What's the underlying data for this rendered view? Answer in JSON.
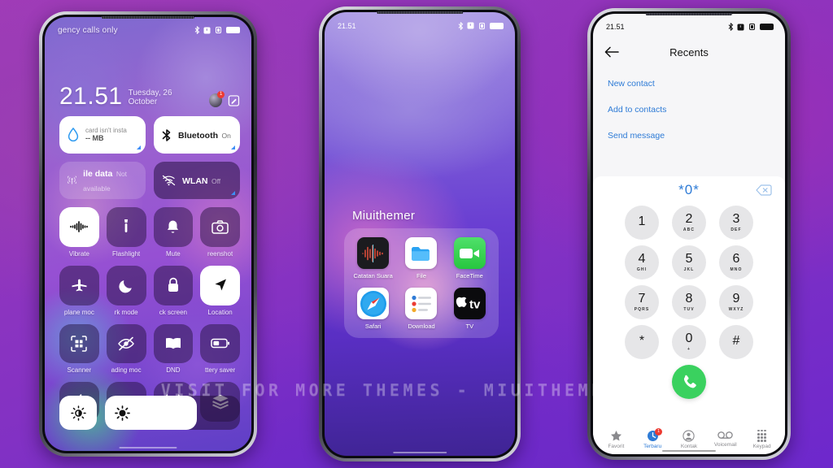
{
  "watermark": "VISIT FOR MORE THEMES - MIUITHEMER.COM",
  "phone_left": {
    "status": {
      "carrier": "gency calls only",
      "icons": [
        "bluetooth-icon",
        "alarm-icon",
        "vibrate-icon",
        "battery-icon"
      ]
    },
    "clock": {
      "time": "21.51",
      "date": "Tuesday, 26 October",
      "notification_count": "1"
    },
    "big_tiles": [
      {
        "name": "sim",
        "title": "card isn't insta",
        "subtitle": "-- MB",
        "state": "on",
        "icon": "water-drop-icon"
      },
      {
        "name": "bluetooth",
        "title": "Bluetooth",
        "subtitle": "On",
        "state": "on",
        "icon": "bluetooth-icon"
      },
      {
        "name": "mobile-data",
        "title": "ile data",
        "subtitle": "Not available",
        "state": "off",
        "icon": "signal-icon"
      },
      {
        "name": "wlan",
        "title": "WLAN",
        "subtitle": "Off",
        "state": "dim",
        "icon": "wifi-off-icon"
      }
    ],
    "tiles": [
      {
        "label": "Vibrate",
        "icon": "vibrate-icon",
        "active": true
      },
      {
        "label": "Flashlight",
        "icon": "flashlight-icon",
        "active": false
      },
      {
        "label": "Mute",
        "icon": "bell-icon",
        "active": false
      },
      {
        "label": "reenshot",
        "icon": "camera-icon",
        "active": false
      },
      {
        "label": "plane moc",
        "icon": "airplane-icon",
        "active": false
      },
      {
        "label": "rk mode",
        "icon": "moon-icon",
        "active": false
      },
      {
        "label": "ck screen",
        "icon": "lock-icon",
        "active": false
      },
      {
        "label": "Location",
        "icon": "location-icon",
        "active": true
      },
      {
        "label": "Scanner",
        "icon": "scanner-icon",
        "active": false
      },
      {
        "label": "ading moc",
        "icon": "eye-off-icon",
        "active": false
      },
      {
        "label": "DND",
        "icon": "book-icon",
        "active": false
      },
      {
        "label": "ttery saver",
        "icon": "battery-saver-icon",
        "active": false
      },
      {
        "label": "",
        "icon": "bolt-icon",
        "active": false
      },
      {
        "label": "",
        "icon": "cast-icon",
        "active": false
      },
      {
        "label": "",
        "icon": "hotspot-icon",
        "active": false
      },
      {
        "label": "",
        "icon": "layers-icon",
        "active": false
      }
    ],
    "brightness": {
      "auto_icon": "auto-brightness-icon",
      "slider_icon": "brightness-icon",
      "value": 68
    }
  },
  "phone_center": {
    "status": {
      "time": "21.51",
      "icons": [
        "bluetooth-icon",
        "alarm-icon",
        "vibrate-icon",
        "battery-icon"
      ]
    },
    "folder_title": "Miuithemer",
    "apps": [
      {
        "label": "Catatan Suara",
        "icon": "voice-memos-icon"
      },
      {
        "label": "File",
        "icon": "files-icon"
      },
      {
        "label": "FaceTime",
        "icon": "facetime-icon"
      },
      {
        "label": "Safari",
        "icon": "safari-icon"
      },
      {
        "label": "Download",
        "icon": "reminders-icon"
      },
      {
        "label": "TV",
        "icon": "apple-tv-icon"
      }
    ]
  },
  "phone_right": {
    "status": {
      "time": "21.51",
      "icons": [
        "bluetooth-icon",
        "alarm-icon",
        "vibrate-icon",
        "battery-icon"
      ]
    },
    "header": {
      "back_icon": "back-arrow-icon",
      "title": "Recents"
    },
    "actions": [
      "New contact",
      "Add to contacts",
      "Send message"
    ],
    "dial": {
      "number": "*0*",
      "delete_icon": "backspace-icon",
      "keys": [
        {
          "num": "1",
          "letters": ""
        },
        {
          "num": "2",
          "letters": "ABC"
        },
        {
          "num": "3",
          "letters": "DEF"
        },
        {
          "num": "4",
          "letters": "GHI"
        },
        {
          "num": "5",
          "letters": "JKL"
        },
        {
          "num": "6",
          "letters": "MNO"
        },
        {
          "num": "7",
          "letters": "PQRS"
        },
        {
          "num": "8",
          "letters": "TUV"
        },
        {
          "num": "9",
          "letters": "WXYZ"
        },
        {
          "num": "*",
          "letters": ""
        },
        {
          "num": "0",
          "letters": "+"
        },
        {
          "num": "#",
          "letters": ""
        }
      ],
      "call_icon": "phone-call-icon"
    },
    "tabs": [
      {
        "label": "Favorit",
        "icon": "star-icon",
        "active": false,
        "badge": ""
      },
      {
        "label": "Terbaru",
        "icon": "recents-icon",
        "active": true,
        "badge": "1"
      },
      {
        "label": "Kontak",
        "icon": "contacts-icon",
        "active": false,
        "badge": ""
      },
      {
        "label": "Voicemail",
        "icon": "voicemail-icon",
        "active": false,
        "badge": ""
      },
      {
        "label": "Keypad",
        "icon": "keypad-icon",
        "active": false,
        "badge": ""
      }
    ]
  },
  "colors": {
    "accent_blue": "#2e7bd6",
    "call_green": "#3ad15f",
    "badge_red": "#ec3b32"
  }
}
